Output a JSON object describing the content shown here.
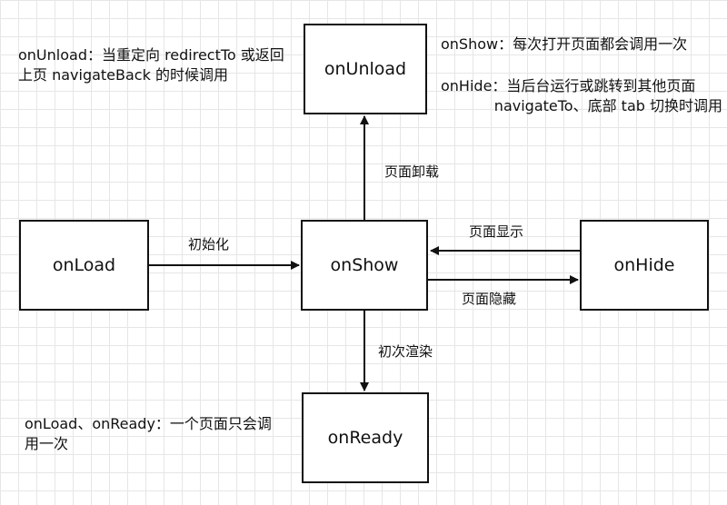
{
  "nodes": {
    "onload": "onLoad",
    "onshow": "onShow",
    "onhide": "onHide",
    "onunload": "onUnload",
    "onready": "onReady"
  },
  "edges": {
    "init": "初始化",
    "unload": "页面卸载",
    "show": "页面显示",
    "hide": "页面隐藏",
    "first_render": "初次渲染"
  },
  "notes": {
    "onunload_note": "onUnload：当重定向 redirectTo 或返回上页 navigateBack 的时候调用",
    "onshow_note": "onShow：每次打开页面都会调用一次",
    "onhide_note_line1": "onHide：当后台运行或跳转到其他页面",
    "onhide_note_line2": "navigateTo、底部 tab 切换时调用",
    "onload_ready_note": "onLoad、onReady：一个页面只会调用一次"
  },
  "colors": {
    "line": "#111111",
    "grid": "#e6e6e6",
    "box_fill": "#ffffff"
  }
}
